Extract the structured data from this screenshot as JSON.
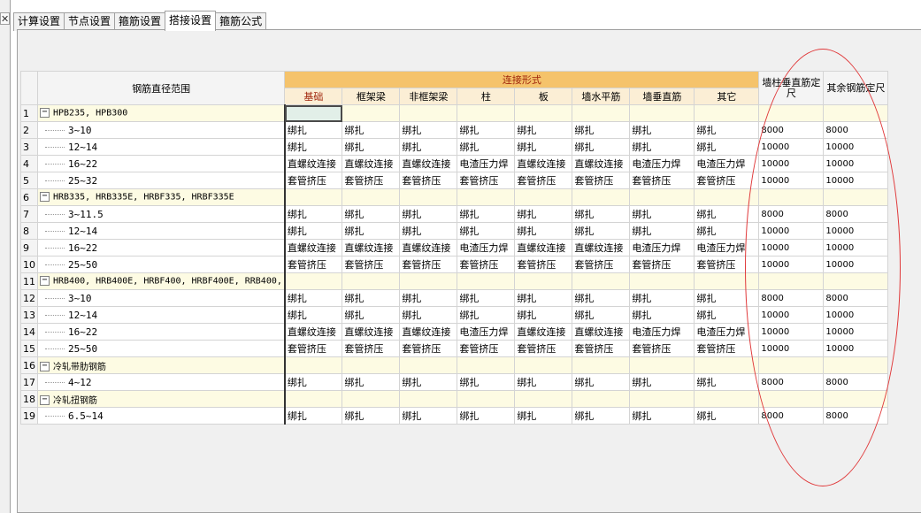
{
  "left_panel": {
    "close_label": "✕"
  },
  "tabs": [
    {
      "label": "计算设置",
      "active": false
    },
    {
      "label": "节点设置",
      "active": false
    },
    {
      "label": "箍筋设置",
      "active": false
    },
    {
      "label": "搭接设置",
      "active": true
    },
    {
      "label": "箍筋公式",
      "active": false
    }
  ],
  "table": {
    "headers": {
      "range": "钢筋直径范围",
      "connection_group": "连接形式",
      "connection_types": [
        "基础",
        "框架梁",
        "非框架梁",
        "柱",
        "板",
        "墙水平筋",
        "墙垂直筋",
        "其它"
      ],
      "wall_column_length": "墙柱垂直筋定尺",
      "other_length": "其余钢筋定尺"
    },
    "rows": [
      {
        "num": "1",
        "type": "group",
        "name": "HPB235, HPB300",
        "cells": [
          "",
          "",
          "",
          "",
          "",
          "",
          "",
          ""
        ],
        "wall": "",
        "other": ""
      },
      {
        "num": "2",
        "type": "child",
        "name": "3~10",
        "cells": [
          "绑扎",
          "绑扎",
          "绑扎",
          "绑扎",
          "绑扎",
          "绑扎",
          "绑扎",
          "绑扎"
        ],
        "wall": "8000",
        "other": "8000"
      },
      {
        "num": "3",
        "type": "child",
        "name": "12~14",
        "cells": [
          "绑扎",
          "绑扎",
          "绑扎",
          "绑扎",
          "绑扎",
          "绑扎",
          "绑扎",
          "绑扎"
        ],
        "wall": "10000",
        "other": "10000"
      },
      {
        "num": "4",
        "type": "child",
        "name": "16~22",
        "cells": [
          "直螺纹连接",
          "直螺纹连接",
          "直螺纹连接",
          "电渣压力焊",
          "直螺纹连接",
          "直螺纹连接",
          "电渣压力焊",
          "电渣压力焊"
        ],
        "wall": "10000",
        "other": "10000"
      },
      {
        "num": "5",
        "type": "child",
        "name": "25~32",
        "cells": [
          "套管挤压",
          "套管挤压",
          "套管挤压",
          "套管挤压",
          "套管挤压",
          "套管挤压",
          "套管挤压",
          "套管挤压"
        ],
        "wall": "10000",
        "other": "10000"
      },
      {
        "num": "6",
        "type": "group",
        "name": "HRB335, HRB335E, HRBF335, HRBF335E",
        "cells": [
          "",
          "",
          "",
          "",
          "",
          "",
          "",
          ""
        ],
        "wall": "",
        "other": ""
      },
      {
        "num": "7",
        "type": "child",
        "name": "3~11.5",
        "cells": [
          "绑扎",
          "绑扎",
          "绑扎",
          "绑扎",
          "绑扎",
          "绑扎",
          "绑扎",
          "绑扎"
        ],
        "wall": "8000",
        "other": "8000"
      },
      {
        "num": "8",
        "type": "child",
        "name": "12~14",
        "cells": [
          "绑扎",
          "绑扎",
          "绑扎",
          "绑扎",
          "绑扎",
          "绑扎",
          "绑扎",
          "绑扎"
        ],
        "wall": "10000",
        "other": "10000"
      },
      {
        "num": "9",
        "type": "child",
        "name": "16~22",
        "cells": [
          "直螺纹连接",
          "直螺纹连接",
          "直螺纹连接",
          "电渣压力焊",
          "直螺纹连接",
          "直螺纹连接",
          "电渣压力焊",
          "电渣压力焊"
        ],
        "wall": "10000",
        "other": "10000"
      },
      {
        "num": "10",
        "type": "child",
        "name": "25~50",
        "cells": [
          "套管挤压",
          "套管挤压",
          "套管挤压",
          "套管挤压",
          "套管挤压",
          "套管挤压",
          "套管挤压",
          "套管挤压"
        ],
        "wall": "10000",
        "other": "10000"
      },
      {
        "num": "11",
        "type": "group",
        "name": "HRB400, HRB400E, HRBF400, HRBF400E, RRB400,",
        "cells": [
          "",
          "",
          "",
          "",
          "",
          "",
          "",
          ""
        ],
        "wall": "",
        "other": ""
      },
      {
        "num": "12",
        "type": "child",
        "name": "3~10",
        "cells": [
          "绑扎",
          "绑扎",
          "绑扎",
          "绑扎",
          "绑扎",
          "绑扎",
          "绑扎",
          "绑扎"
        ],
        "wall": "8000",
        "other": "8000"
      },
      {
        "num": "13",
        "type": "child",
        "name": "12~14",
        "cells": [
          "绑扎",
          "绑扎",
          "绑扎",
          "绑扎",
          "绑扎",
          "绑扎",
          "绑扎",
          "绑扎"
        ],
        "wall": "10000",
        "other": "10000"
      },
      {
        "num": "14",
        "type": "child",
        "name": "16~22",
        "cells": [
          "直螺纹连接",
          "直螺纹连接",
          "直螺纹连接",
          "电渣压力焊",
          "直螺纹连接",
          "直螺纹连接",
          "电渣压力焊",
          "电渣压力焊"
        ],
        "wall": "10000",
        "other": "10000"
      },
      {
        "num": "15",
        "type": "child",
        "name": "25~50",
        "cells": [
          "套管挤压",
          "套管挤压",
          "套管挤压",
          "套管挤压",
          "套管挤压",
          "套管挤压",
          "套管挤压",
          "套管挤压"
        ],
        "wall": "10000",
        "other": "10000"
      },
      {
        "num": "16",
        "type": "group",
        "name": "冷轧带肋钢筋",
        "cells": [
          "",
          "",
          "",
          "",
          "",
          "",
          "",
          ""
        ],
        "wall": "",
        "other": ""
      },
      {
        "num": "17",
        "type": "child",
        "name": "4~12",
        "cells": [
          "绑扎",
          "绑扎",
          "绑扎",
          "绑扎",
          "绑扎",
          "绑扎",
          "绑扎",
          "绑扎"
        ],
        "wall": "8000",
        "other": "8000"
      },
      {
        "num": "18",
        "type": "group",
        "name": "冷轧扭钢筋",
        "cells": [
          "",
          "",
          "",
          "",
          "",
          "",
          "",
          ""
        ],
        "wall": "",
        "other": ""
      },
      {
        "num": "19",
        "type": "child",
        "name": "6.5~14",
        "cells": [
          "绑扎",
          "绑扎",
          "绑扎",
          "绑扎",
          "绑扎",
          "绑扎",
          "绑扎",
          "绑扎"
        ],
        "wall": "8000",
        "other": "8000"
      }
    ]
  },
  "colors": {
    "connection_header": "#f5c36b",
    "connection_header_text": "#a0260c",
    "group_row_background": "#fdfbe3",
    "annotation_circle": "#e0393a"
  }
}
